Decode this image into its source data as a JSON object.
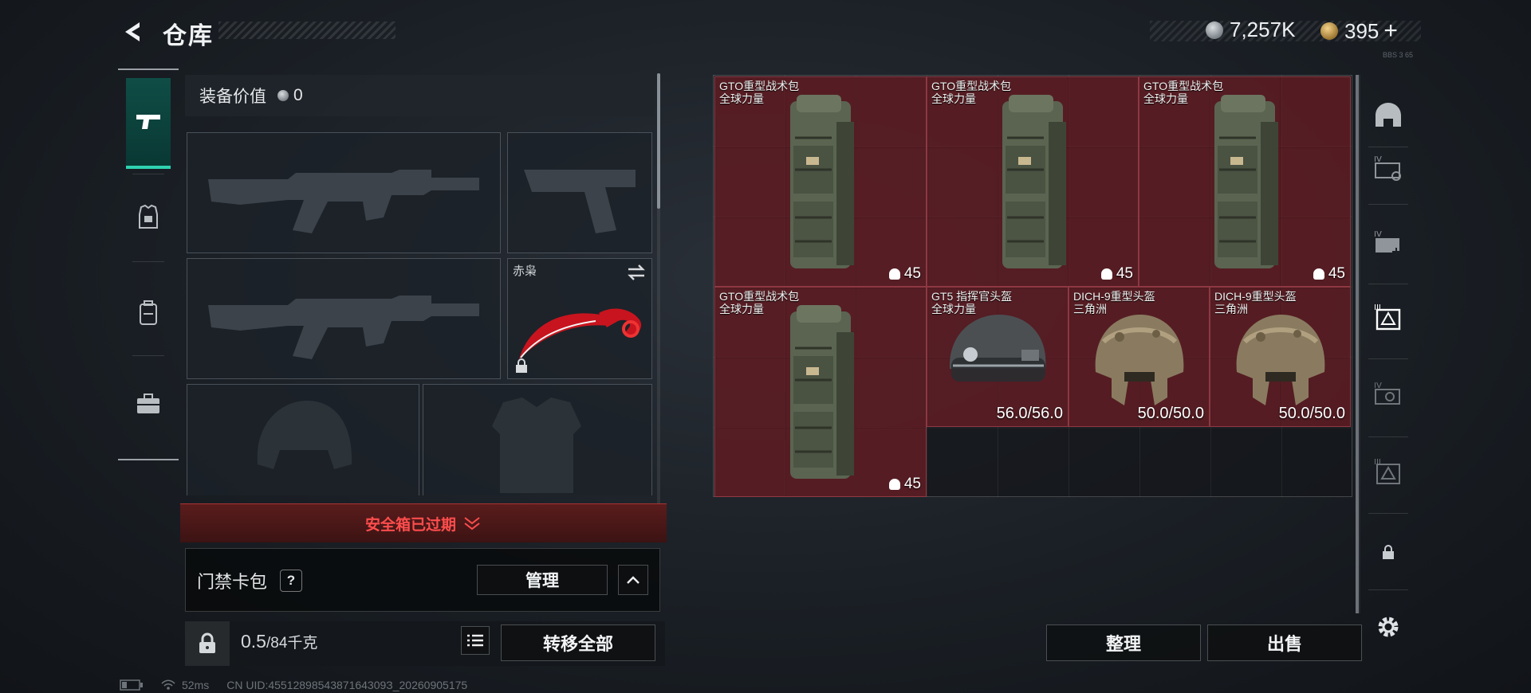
{
  "header": {
    "title": "仓库",
    "silver": "7,257K",
    "gold": "395",
    "plus": "+",
    "version": "BBS 3 65"
  },
  "left_nav": {
    "items": [
      {
        "name": "weapons-tab",
        "icon": "pistol-icon",
        "active": true
      },
      {
        "name": "gear-tab",
        "icon": "armor-icon",
        "active": false
      },
      {
        "name": "backpack-tab",
        "icon": "backpack-icon",
        "active": false
      },
      {
        "name": "case-tab",
        "icon": "briefcase-icon",
        "active": false
      }
    ]
  },
  "loadout": {
    "value_label": "装备价值",
    "value": "0",
    "melee_name": "赤枭",
    "slots": [
      "primary-weapon-1",
      "pistol",
      "primary-weapon-2",
      "melee",
      "helmet",
      "body-armor"
    ]
  },
  "safe_box": {
    "expired_text": "安全箱已过期"
  },
  "keycard": {
    "title": "门禁卡包",
    "help": "?",
    "manage_label": "管理"
  },
  "bottom": {
    "weight_current": "0.5",
    "weight_max": "/84千克",
    "transfer_all_label": "转移全部"
  },
  "inventory": {
    "items": [
      {
        "name": "GTO重型战术包",
        "sub": "全球力量",
        "count": "45",
        "type": "backpack"
      },
      {
        "name": "GTO重型战术包",
        "sub": "全球力量",
        "count": "45",
        "type": "backpack"
      },
      {
        "name": "GTO重型战术包",
        "sub": "全球力量",
        "count": "45",
        "type": "backpack"
      },
      {
        "name": "GTO重型战术包",
        "sub": "全球力量",
        "count": "45",
        "type": "backpack"
      },
      {
        "name": "GT5 指挥官头盔",
        "sub": "全球力量",
        "durability": "56.0/56.0",
        "type": "helmet-gt5"
      },
      {
        "name": "DICH-9重型头盔",
        "sub": "三角洲",
        "durability": "50.0/50.0",
        "type": "helmet-dich"
      },
      {
        "name": "DICH-9重型头盔",
        "sub": "三角洲",
        "durability": "50.0/50.0",
        "type": "helmet-dich"
      }
    ]
  },
  "actions": {
    "sort_label": "整理",
    "sell_label": "出售"
  },
  "status_bar": {
    "ping": "52ms",
    "uid": "CN UID:4551289854387164309З_20260905175"
  },
  "colors": {
    "accent": "#2fd1b0",
    "item_bg": "#6e1e26",
    "warning": "#ff4d4d"
  }
}
